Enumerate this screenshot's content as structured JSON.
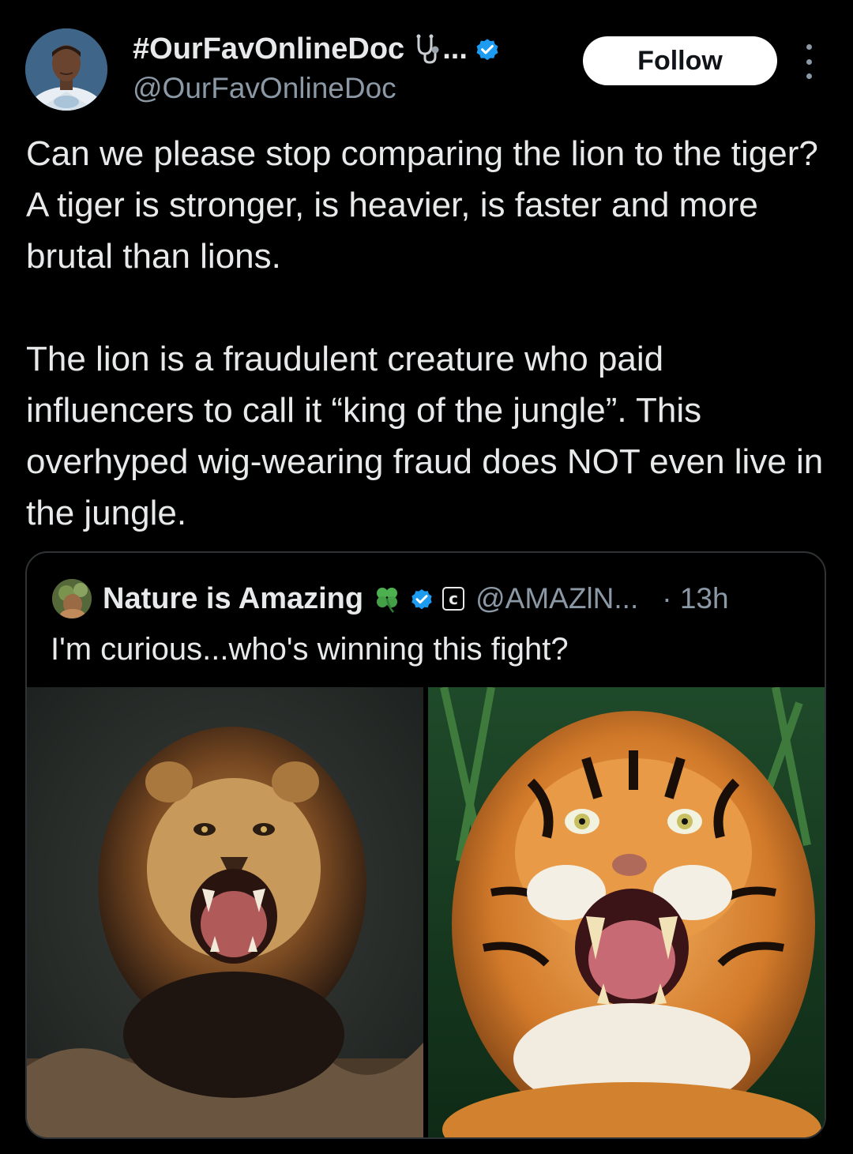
{
  "tweet": {
    "author": {
      "display_name": "#OurFavOnlineDoc",
      "name_emoji_icon": "stethoscope-icon",
      "name_truncation": "...",
      "verified_icon": "verified-badge-icon",
      "handle": "@OurFavOnlineDoc"
    },
    "follow_label": "Follow",
    "more_icon": "more-vertical-icon",
    "paragraphs": [
      "Can we please stop comparing the lion to the tiger? A tiger is stronger, is heavier, is faster and more brutal than lions.",
      "The lion is a fraudulent creature who paid influencers to call it “king of the jungle”. This overhyped wig-wearing fraud does NOT even live in the jungle."
    ]
  },
  "quoted_tweet": {
    "display_name": "Nature is Amazing",
    "name_emoji_icon": "four-leaf-clover-icon",
    "verified_icon": "verified-badge-icon",
    "affiliate_badge": "c",
    "handle": "@AMAZlN...",
    "time": "· 13h",
    "text": "I'm curious...who's winning this fight?",
    "media": [
      {
        "icon": "lion-photo"
      },
      {
        "icon": "tiger-photo"
      }
    ]
  },
  "colors": {
    "background": "#000000",
    "text_primary": "#e7e9ea",
    "text_secondary": "#8b98a5",
    "verified_blue": "#1d9bf0",
    "border": "#2f3336",
    "follow_bg": "#ffffff"
  }
}
